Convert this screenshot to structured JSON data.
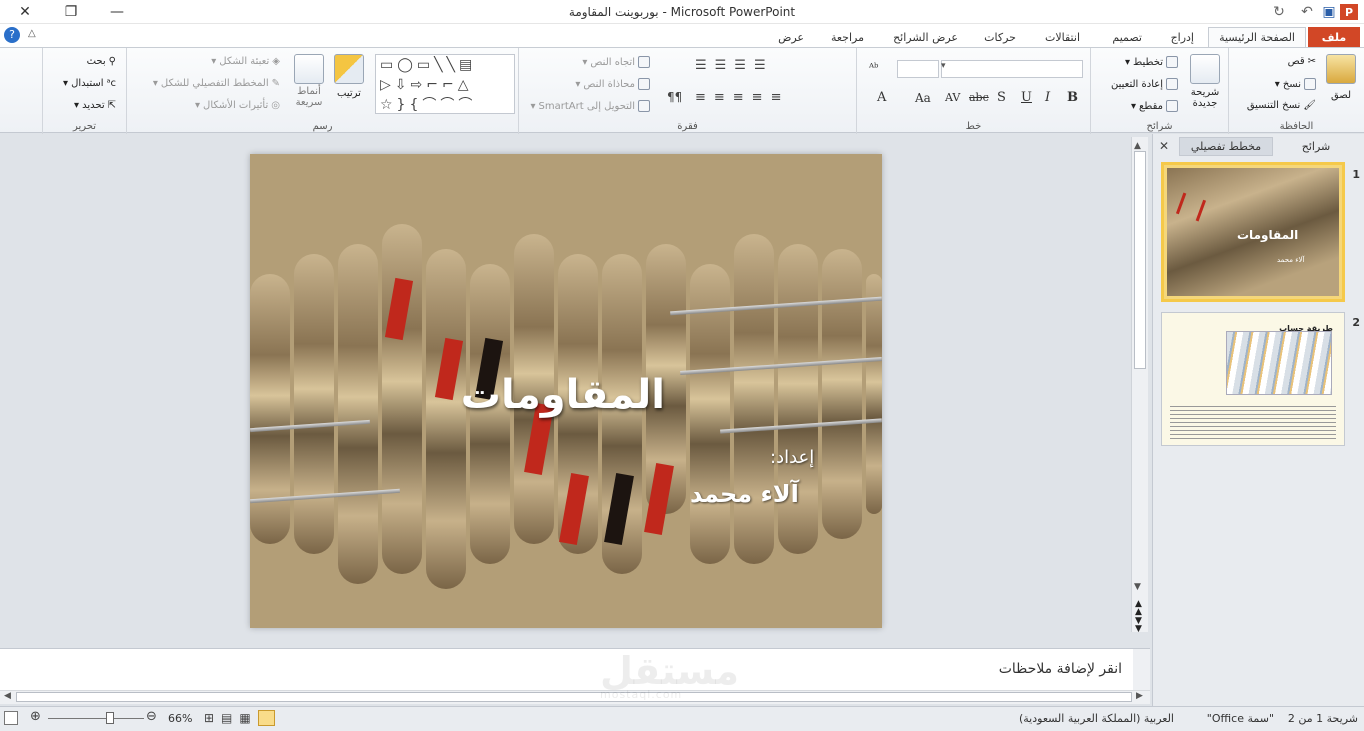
{
  "window": {
    "title": "بوربوينت المقاومة  -  Microsoft PowerPoint"
  },
  "tabs": [
    "ملف",
    "الصفحة الرئيسية",
    "إدراج",
    "تصميم",
    "انتقالات",
    "حركات",
    "عرض الشرائح",
    "مراجعة",
    "عرض"
  ],
  "ribbon": {
    "clipboard": {
      "label": "الحافظة",
      "paste": "لصق",
      "cut": "قص",
      "copy": "نسخ",
      "format_painter": "نسخ التنسيق"
    },
    "slides": {
      "label": "شرائح",
      "new_slide": "شريحة جديدة",
      "layout": "تخطيط",
      "reset": "إعادة التعيين",
      "section": "مقطع"
    },
    "font": {
      "label": "خط"
    },
    "paragraph": {
      "label": "فقرة",
      "text_direction": "اتجاه النص",
      "align_text": "محاذاة النص",
      "smartart": "التحويل إلى SmartArt"
    },
    "drawing": {
      "label": "رسم",
      "arrange": "ترتيب",
      "quick_styles": "أنماط سريعة",
      "shape_fill": "تعبئة الشكل",
      "shape_outline": "المخطط التفصيلي للشكل",
      "shape_effects": "تأثيرات الأشكال"
    },
    "editing": {
      "label": "تحرير",
      "find": "بحث",
      "replace": "استبدال",
      "select": "تحديد"
    }
  },
  "slide": {
    "title": "المقاومات",
    "prepared_by": "إعداد:",
    "author": "آلاء محمد"
  },
  "panel": {
    "tab_slides": "شرائح",
    "tab_outline": "مخطط تفصيلي",
    "thumb1_num": "1",
    "thumb2_num": "2",
    "thumb1_title": "المقاومات",
    "thumb1_author": "آلاء محمد",
    "thumb2_title": "طريقة حساب المقاومة بالألوان"
  },
  "notes": {
    "placeholder": "انقر لإضافة ملاحظات"
  },
  "status": {
    "slide_of": "شريحة 1 من 2",
    "theme": "\"سمة Office\"",
    "language": "العربية (المملكة العربية السعودية)",
    "zoom": "66%"
  },
  "watermark": {
    "text": "مستقل",
    "sub": "mostaql.com"
  }
}
